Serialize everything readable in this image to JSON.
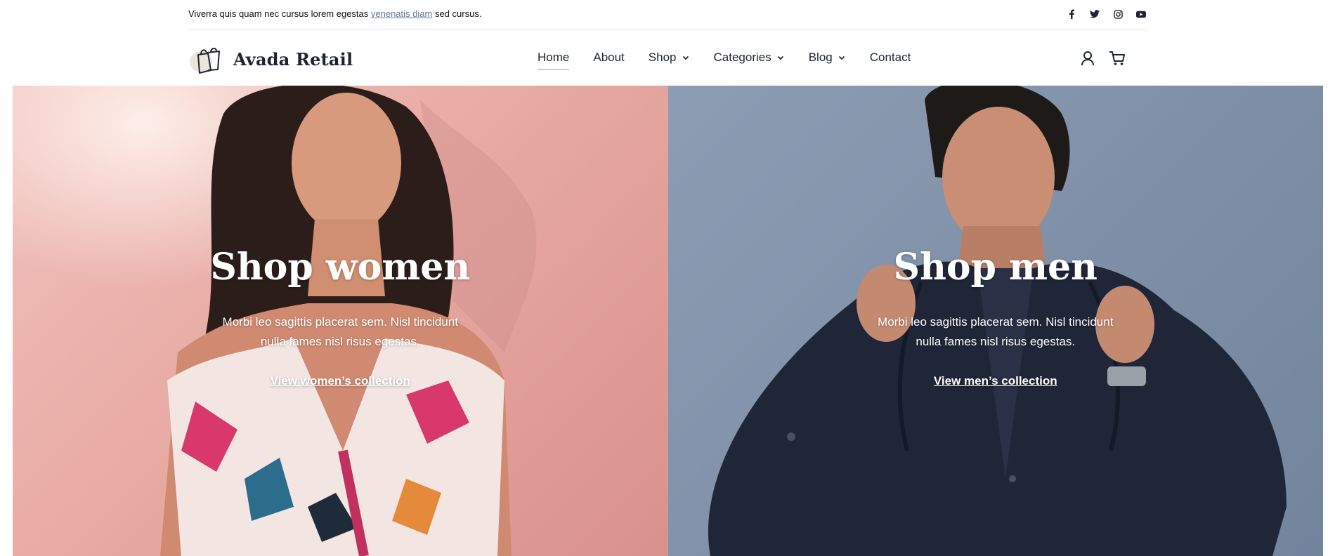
{
  "topbar": {
    "text_before": "Viverra quis quam nec cursus lorem egestas ",
    "link": "venenatis diam",
    "text_after": " sed cursus.",
    "social": [
      "facebook-icon",
      "twitter-icon",
      "instagram-icon",
      "youtube-icon"
    ]
  },
  "header": {
    "logo_text": "Avada Retail",
    "nav": [
      {
        "label": "Home",
        "active": true,
        "dropdown": false
      },
      {
        "label": "About",
        "active": false,
        "dropdown": false
      },
      {
        "label": "Shop",
        "active": false,
        "dropdown": true
      },
      {
        "label": "Categories",
        "active": false,
        "dropdown": true
      },
      {
        "label": "Blog",
        "active": false,
        "dropdown": true
      },
      {
        "label": "Contact",
        "active": false,
        "dropdown": false
      }
    ],
    "icons": [
      "account-icon",
      "cart-icon"
    ]
  },
  "hero": {
    "women": {
      "title": "Shop women",
      "desc": "Morbi leo sagittis placerat sem. Nisl tincidunt nulla fames nisl risus egestas.",
      "link": "View women’s collection"
    },
    "men": {
      "title": "Shop men",
      "desc": "Morbi leo sagittis placerat sem. Nisl tincidunt nulla fames nisl risus egestas.",
      "link": "View men’s collection"
    }
  },
  "colors": {
    "text_dark": "#1c2434",
    "women_bg": "#e8aaa4",
    "men_bg": "#7f90a8"
  }
}
